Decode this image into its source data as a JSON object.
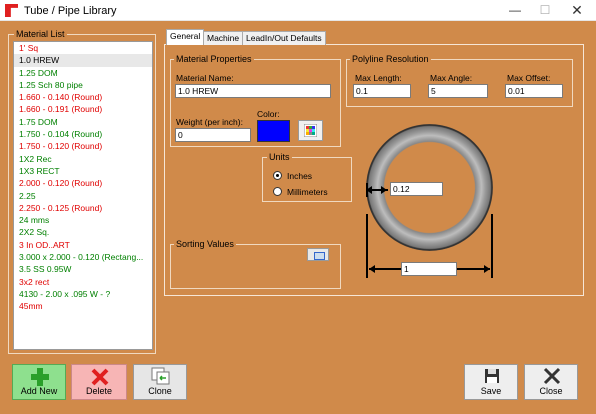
{
  "window": {
    "title": "Tube / Pipe Library",
    "minimize_glyph": "—",
    "maximize_glyph": "☐",
    "close_glyph": "✕"
  },
  "material_list": {
    "title": "Material List",
    "items": [
      {
        "label": "1' Sq",
        "color": "#e00000"
      },
      {
        "label": "1.0 HREW",
        "color": "#000000",
        "selected": true
      },
      {
        "label": "1.25 DOM",
        "color": "#008000"
      },
      {
        "label": "1.25 Sch 80 pipe",
        "color": "#008000"
      },
      {
        "label": "1.660 - 0.140 (Round)",
        "color": "#e00000"
      },
      {
        "label": "1.660 - 0.191 (Round)",
        "color": "#e00000"
      },
      {
        "label": "1.75 DOM",
        "color": "#008000"
      },
      {
        "label": "1.750 - 0.104 (Round)",
        "color": "#008000"
      },
      {
        "label": "1.750 - 0.120 (Round)",
        "color": "#e00000"
      },
      {
        "label": "1X2 Rec",
        "color": "#008000"
      },
      {
        "label": "1X3 RECT",
        "color": "#008000"
      },
      {
        "label": "2.000 - 0.120 (Round)",
        "color": "#e00000"
      },
      {
        "label": "2.25",
        "color": "#008000"
      },
      {
        "label": "2.250 - 0.125 (Round)",
        "color": "#e00000"
      },
      {
        "label": "24 mms",
        "color": "#008000"
      },
      {
        "label": "2X2 Sq.",
        "color": "#008000"
      },
      {
        "label": "3 In OD..ART",
        "color": "#e00000"
      },
      {
        "label": "3.000 x 2.000 - 0.120 (Rectang...",
        "color": "#008000"
      },
      {
        "label": "3.5 SS 0.95W",
        "color": "#008000"
      },
      {
        "label": "3x2 rect",
        "color": "#e00000"
      },
      {
        "label": "4130 - 2.00 x .095  W - ?",
        "color": "#008000"
      },
      {
        "label": "45mm",
        "color": "#e00000"
      }
    ]
  },
  "tabs": [
    {
      "label": "General",
      "active": true
    },
    {
      "label": "Machine",
      "active": false
    },
    {
      "label": "LeadIn/Out Defaults",
      "active": false
    }
  ],
  "material_properties": {
    "title": "Material Properties",
    "name_label": "Material Name:",
    "name_value": "1.0 HREW",
    "weight_label": "Weight (per inch):",
    "weight_value": "0",
    "color_label": "Color:",
    "color_value": "#0000ff"
  },
  "polyline_resolution": {
    "title": "Polyline Resolution",
    "max_length_label": "Max Length:",
    "max_length_value": "0.1",
    "max_angle_label": "Max Angle:",
    "max_angle_value": "5",
    "max_offset_label": "Max Offset:",
    "max_offset_value": "0.01"
  },
  "units": {
    "title": "Units",
    "inches_label": "Inches",
    "millimeters_label": "Millimeters",
    "selected": "Inches"
  },
  "sorting": {
    "title": "Sorting Values"
  },
  "profile": {
    "wall_thickness_value": "0.12",
    "diameter_value": "1"
  },
  "buttons": {
    "add_new": "Add New",
    "delete": "Delete",
    "clone": "Clone",
    "save": "Save",
    "close": "Close"
  }
}
